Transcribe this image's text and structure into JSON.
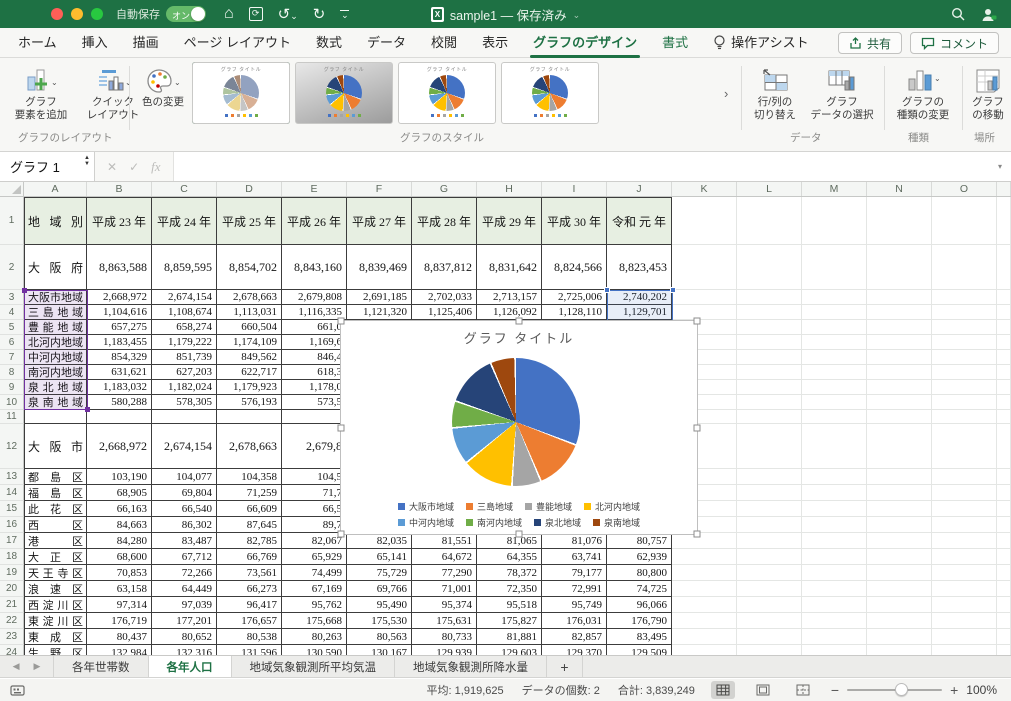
{
  "theme": {
    "title_green": "#1E7144",
    "accent_green": "#1E7144",
    "light_red": "#FF5F57",
    "light_yellow": "#FEBC2E",
    "light_green": "#28C840"
  },
  "titlebar": {
    "autosave_label": "自動保存",
    "autosave_state": "オン",
    "title": "sample1 — 保存済み",
    "doc_icon_letter": "X",
    "undo_glyph": "↺",
    "redo_glyph": "↻",
    "home_glyph": "⌂",
    "sync_glyph": "⟳",
    "chev_glyph": "⌄"
  },
  "tabs": {
    "items": [
      "ホーム",
      "挿入",
      "描画",
      "ページ レイアウト",
      "数式",
      "データ",
      "校閲",
      "表示",
      "グラフのデザイン",
      "書式"
    ],
    "active": "グラフのデザイン",
    "contextual": [
      "書式"
    ],
    "assist": "操作アシスト",
    "share": "共有",
    "comment": "コメント"
  },
  "ribbon": {
    "groups": [
      {
        "label": "グラフのレイアウト",
        "buttons": [
          {
            "label": "グラフ\n要素を追加"
          },
          {
            "label": "クイック\nレイアウト"
          }
        ]
      },
      {
        "label": "グラフのスタイル",
        "buttons": [
          {
            "label": "色の変更"
          }
        ],
        "gallery": {
          "thumb_title": "グラフ タイトル",
          "count": 5,
          "selected_index": 0,
          "more_symbol": "›"
        }
      },
      {
        "label": "データ",
        "buttons": [
          {
            "label": "行/列の\n切り替え"
          },
          {
            "label": "グラフ\nデータの選択"
          }
        ]
      },
      {
        "label": "種類",
        "buttons": [
          {
            "label": "グラフの\n種類の変更"
          }
        ]
      },
      {
        "label": "場所",
        "buttons": [
          {
            "label": "グラフ\nの移動"
          }
        ]
      }
    ]
  },
  "formula_bar": {
    "name_box": "グラフ 1",
    "cancel": "✕",
    "enter": "✓",
    "fx": "fx",
    "chev": "▾"
  },
  "sheet": {
    "col_headers": [
      "A",
      "B",
      "C",
      "D",
      "E",
      "F",
      "G",
      "H",
      "I",
      "J",
      "K",
      "L",
      "M",
      "N",
      "O"
    ],
    "rows": [
      {
        "n": 1,
        "h": 48,
        "kind": "header",
        "label": "地域別",
        "vals": [
          "平成 23 年",
          "平成 24 年",
          "平成 25 年",
          "平成 26 年",
          "平成 27 年",
          "平成 28 年",
          "平成 29 年",
          "平成 30 年",
          "令和 元 年"
        ]
      },
      {
        "n": 2,
        "h": 45,
        "label": "大阪府",
        "vals": [
          "8,863,588",
          "8,859,595",
          "8,854,702",
          "8,843,160",
          "8,839,469",
          "8,837,812",
          "8,831,642",
          "8,824,566",
          "8,823,453"
        ]
      },
      {
        "n": 3,
        "h": 15,
        "label": "大阪市地域",
        "vals": [
          "2,668,972",
          "2,674,154",
          "2,678,663",
          "2,679,808",
          "2,691,185",
          "2,702,033",
          "2,713,157",
          "2,725,006",
          "2,740,202"
        ]
      },
      {
        "n": 4,
        "h": 15,
        "label": "三島地域",
        "vals": [
          "1,104,616",
          "1,108,674",
          "1,113,031",
          "1,116,335",
          "1,121,320",
          "1,125,406",
          "1,126,092",
          "1,128,110",
          "1,129,701"
        ]
      },
      {
        "n": 5,
        "h": 15,
        "label": "豊能地域",
        "vals": [
          "657,275",
          "658,274",
          "660,504",
          "661,0",
          "",
          "",
          "",
          "",
          ""
        ]
      },
      {
        "n": 6,
        "h": 15,
        "label": "北河内地域",
        "vals": [
          "1,183,455",
          "1,179,222",
          "1,174,109",
          "1,169,6",
          "",
          "",
          "",
          "",
          ""
        ]
      },
      {
        "n": 7,
        "h": 15,
        "label": "中河内地域",
        "vals": [
          "854,329",
          "851,739",
          "849,562",
          "846,4",
          "",
          "",
          "",
          "",
          ""
        ]
      },
      {
        "n": 8,
        "h": 15,
        "label": "南河内地域",
        "vals": [
          "631,621",
          "627,203",
          "622,717",
          "618,3",
          "",
          "",
          "",
          "",
          ""
        ]
      },
      {
        "n": 9,
        "h": 15,
        "label": "泉北地域",
        "vals": [
          "1,183,032",
          "1,182,024",
          "1,179,923",
          "1,178,0",
          "",
          "",
          "",
          "",
          ""
        ]
      },
      {
        "n": 10,
        "h": 15,
        "label": "泉南地域",
        "vals": [
          "580,288",
          "578,305",
          "576,193",
          "573,5",
          "",
          "",
          "",
          "",
          ""
        ]
      },
      {
        "n": 11,
        "h": 14,
        "label": "",
        "vals": [
          "",
          "",
          "",
          "",
          "",
          "",
          "",
          "",
          ""
        ]
      },
      {
        "n": 12,
        "h": 45,
        "label": "大阪市",
        "vals": [
          "2,668,972",
          "2,674,154",
          "2,678,663",
          "2,679,8",
          "",
          "",
          "",
          "",
          ""
        ]
      },
      {
        "n": 13,
        "h": 16,
        "label": "都島区",
        "vals": [
          "103,190",
          "104,077",
          "104,358",
          "104,5",
          "",
          "",
          "",
          "",
          ""
        ]
      },
      {
        "n": 14,
        "h": 16,
        "label": "福島区",
        "vals": [
          "68,905",
          "69,804",
          "71,259",
          "71,7",
          "",
          "",
          "",
          "",
          ""
        ]
      },
      {
        "n": 15,
        "h": 16,
        "label": "此花区",
        "vals": [
          "66,163",
          "66,540",
          "66,609",
          "66,5",
          "",
          "",
          "",
          "",
          ""
        ]
      },
      {
        "n": 16,
        "h": 16,
        "label": "西区",
        "vals": [
          "84,663",
          "86,302",
          "87,645",
          "89,7",
          "",
          "",
          "",
          "",
          ""
        ]
      },
      {
        "n": 17,
        "h": 16,
        "label": "港区",
        "vals": [
          "84,280",
          "83,487",
          "82,785",
          "82,067",
          "82,035",
          "81,551",
          "81,065",
          "81,076",
          "80,757"
        ]
      },
      {
        "n": 18,
        "h": 16,
        "label": "大正区",
        "vals": [
          "68,600",
          "67,712",
          "66,769",
          "65,929",
          "65,141",
          "64,672",
          "64,355",
          "63,741",
          "62,939"
        ]
      },
      {
        "n": 19,
        "h": 16,
        "label": "天王寺区",
        "vals": [
          "70,853",
          "72,266",
          "73,561",
          "74,499",
          "75,729",
          "77,290",
          "78,372",
          "79,177",
          "80,800"
        ]
      },
      {
        "n": 20,
        "h": 16,
        "label": "浪速区",
        "vals": [
          "63,158",
          "64,449",
          "66,273",
          "67,169",
          "69,766",
          "71,001",
          "72,350",
          "72,991",
          "74,725"
        ]
      },
      {
        "n": 21,
        "h": 16,
        "label": "西淀川区",
        "vals": [
          "97,314",
          "97,039",
          "96,417",
          "95,762",
          "95,490",
          "95,374",
          "95,518",
          "95,749",
          "96,066"
        ]
      },
      {
        "n": 22,
        "h": 16,
        "label": "東淀川区",
        "vals": [
          "176,719",
          "177,201",
          "176,657",
          "175,668",
          "175,530",
          "175,631",
          "175,827",
          "176,031",
          "176,790"
        ]
      },
      {
        "n": 23,
        "h": 16,
        "label": "東成区",
        "vals": [
          "80,437",
          "80,652",
          "80,538",
          "80,263",
          "80,563",
          "80,733",
          "81,881",
          "82,857",
          "83,495"
        ]
      },
      {
        "n": 24,
        "h": 16,
        "label": "生野区",
        "vals": [
          "132,984",
          "132,316",
          "131,596",
          "130,590",
          "130,167",
          "129,939",
          "129,603",
          "129,370",
          "129,509"
        ]
      }
    ]
  },
  "chart_data": {
    "type": "pie",
    "title": "グラフ タイトル",
    "categories": [
      "大阪市地域",
      "三島地域",
      "豊能地域",
      "北河内地域",
      "中河内地域",
      "南河内地域",
      "泉北地域",
      "泉南地域"
    ],
    "values": [
      2740202,
      1129701,
      652000,
      1152000,
      833000,
      600000,
      1164000,
      553000
    ],
    "visible_values": {
      "大阪市地域": "2,740,202",
      "三島地域": "1,129,701"
    },
    "colors": [
      "#4472C4",
      "#ED7D31",
      "#A5A5A5",
      "#FFC000",
      "#5B9BD5",
      "#70AD47",
      "#264478",
      "#9E480E"
    ],
    "legend_position": "bottom",
    "legend_rows": [
      [
        0,
        1,
        2,
        3
      ],
      [
        4,
        5,
        6,
        7
      ]
    ]
  },
  "sheet_tabs": {
    "items": [
      "各年世帯数",
      "各年人口",
      "地域気象観測所平均気温",
      "地域気象観測所降水量"
    ],
    "active": "各年人口",
    "add": "+",
    "prev": "◀",
    "next": "▶"
  },
  "status_bar": {
    "average_label": "平均:",
    "average_value": "1,919,625",
    "count_label": "データの個数:",
    "count_value": "2",
    "sum_label": "合計:",
    "sum_value": "3,839,249",
    "zoom_out": "−",
    "zoom_in": "+",
    "zoom": "100%"
  }
}
